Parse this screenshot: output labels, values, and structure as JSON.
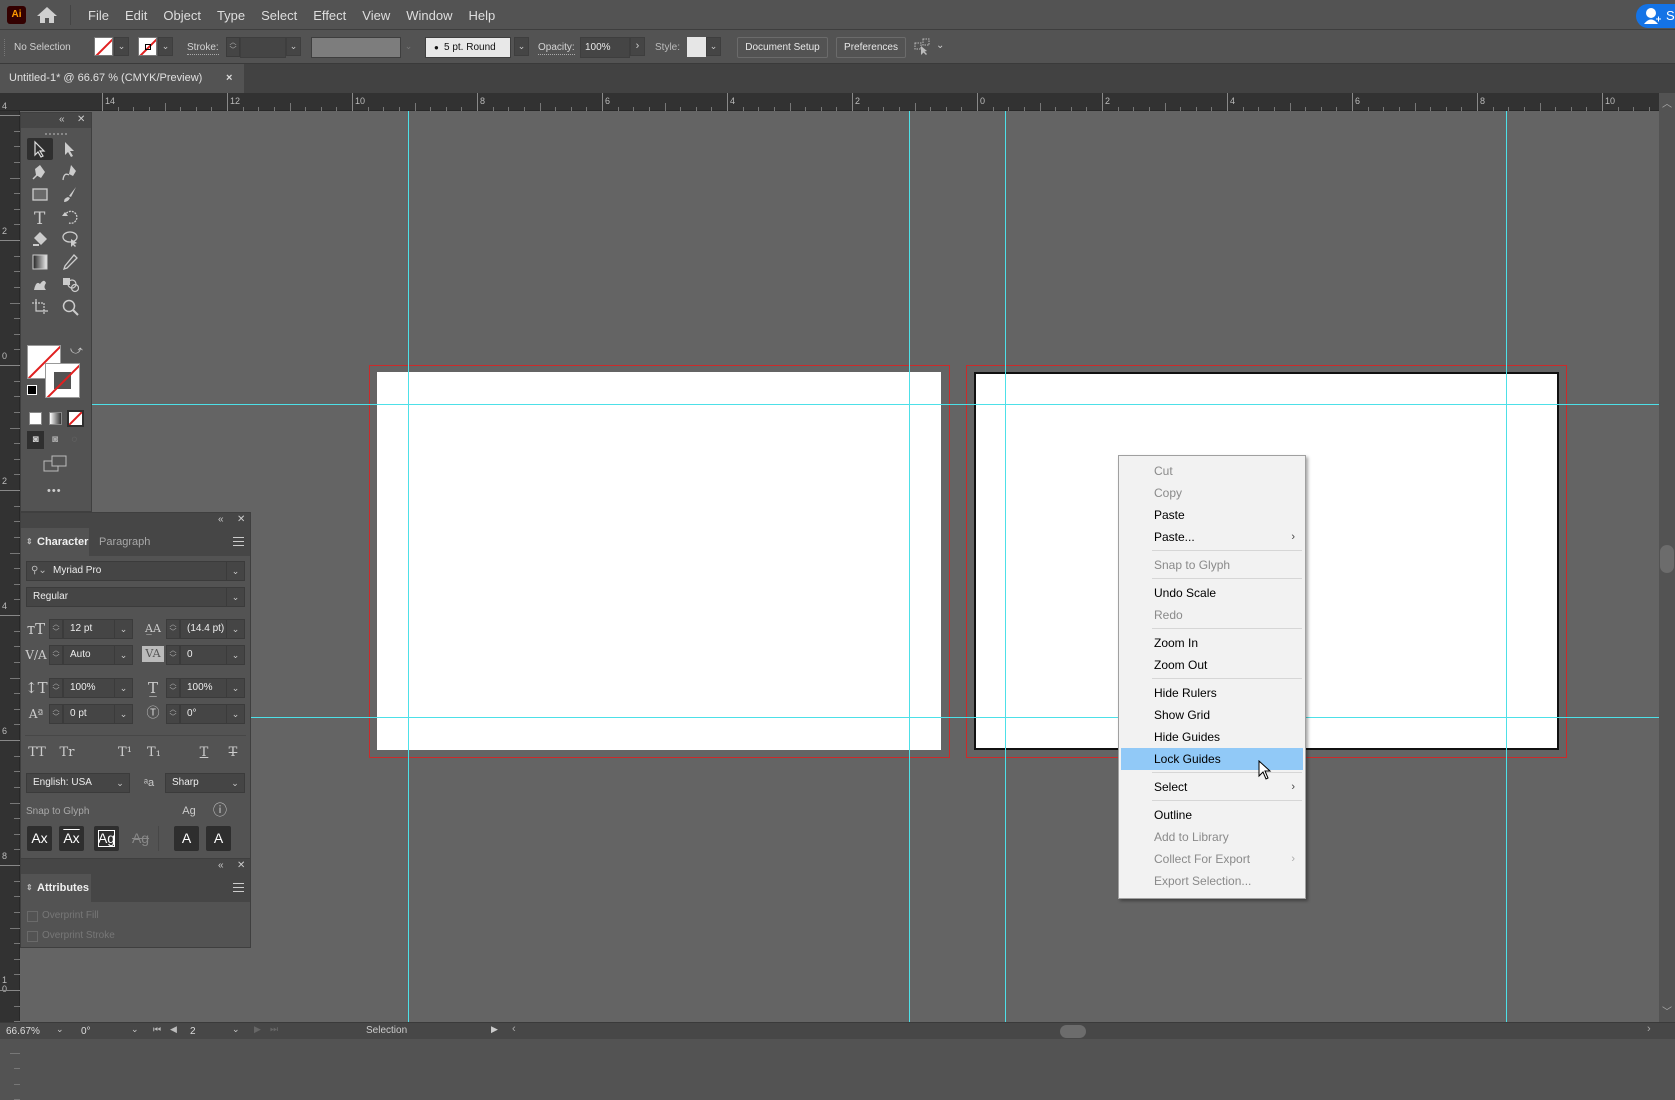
{
  "app": {
    "logo": "Ai",
    "menus": [
      "File",
      "Edit",
      "Object",
      "Type",
      "Select",
      "Effect",
      "View",
      "Window",
      "Help"
    ],
    "share_label": "S"
  },
  "control_bar": {
    "selection_status": "No Selection",
    "stroke_label": "Stroke:",
    "stroke_value": "",
    "brush_label": "5 pt. Round",
    "opacity_label": "Opacity:",
    "opacity_value": "100%",
    "style_label": "Style:",
    "document_setup_label": "Document Setup",
    "preferences_label": "Preferences"
  },
  "document_tab": {
    "title": "Untitled-1* @ 66.67 % (CMYK/Preview)",
    "close_glyph": "×"
  },
  "rulers": {
    "horizontal_labels": [
      "14",
      "12",
      "10",
      "8",
      "6",
      "4",
      "2",
      "0",
      "2",
      "4",
      "6",
      "8",
      "10"
    ],
    "vertical_labels": [
      "4",
      "2",
      "0",
      "2",
      "4",
      "6",
      "8",
      "10"
    ]
  },
  "tools_panel": {
    "tools": [
      {
        "name": "selection-tool",
        "active": true
      },
      {
        "name": "direct-selection-tool",
        "active": false
      },
      {
        "name": "pen-tool",
        "active": false
      },
      {
        "name": "curvature-tool",
        "active": false
      },
      {
        "name": "rectangle-tool",
        "active": false
      },
      {
        "name": "paintbrush-tool",
        "active": false
      },
      {
        "name": "type-tool",
        "active": false
      },
      {
        "name": "rotate-tool",
        "active": false
      },
      {
        "name": "eraser-tool",
        "active": false
      },
      {
        "name": "lasso-tool",
        "active": false
      },
      {
        "name": "gradient-tool",
        "active": false
      },
      {
        "name": "eyedropper-tool",
        "active": false
      },
      {
        "name": "puppet-warp-tool",
        "active": false
      },
      {
        "name": "shape-builder-tool",
        "active": false
      },
      {
        "name": "artboard-tool",
        "active": false
      },
      {
        "name": "zoom-tool",
        "active": false
      }
    ],
    "more_label": "•••"
  },
  "character_panel": {
    "tabs": [
      "Character",
      "Paragraph"
    ],
    "active_tab": "Character",
    "font_family": "Myriad Pro",
    "font_style": "Regular",
    "font_size": "12 pt",
    "leading": "(14.4 pt)",
    "kerning": "Auto",
    "tracking": "0",
    "vertical_scale": "100%",
    "horizontal_scale": "100%",
    "baseline_shift": "0 pt",
    "character_rotation": "0°",
    "case_buttons": [
      "TT",
      "Tr",
      "T¹",
      "T₁",
      "T",
      "T"
    ],
    "language": "English: USA",
    "antialiasing": "Sharp",
    "snap_to_glyph_label": "Snap to Glyph",
    "snap_buttons": [
      "Ax",
      "Ax",
      "Ag",
      "Ag",
      "A",
      "A"
    ]
  },
  "attributes_panel": {
    "title": "Attributes",
    "options": [
      {
        "label": "Overprint Fill",
        "checked": false
      },
      {
        "label": "Overprint Stroke",
        "checked": false
      }
    ]
  },
  "context_menu": {
    "groups": [
      [
        {
          "label": "Cut",
          "enabled": false,
          "submenu": false
        },
        {
          "label": "Copy",
          "enabled": false,
          "submenu": false
        },
        {
          "label": "Paste",
          "enabled": true,
          "submenu": false
        },
        {
          "label": "Paste...",
          "enabled": true,
          "submenu": true
        }
      ],
      [
        {
          "label": "Snap to Glyph",
          "enabled": false,
          "submenu": false
        }
      ],
      [
        {
          "label": "Undo Scale",
          "enabled": true,
          "submenu": false
        },
        {
          "label": "Redo",
          "enabled": false,
          "submenu": false
        }
      ],
      [
        {
          "label": "Zoom In",
          "enabled": true,
          "submenu": false
        },
        {
          "label": "Zoom Out",
          "enabled": true,
          "submenu": false
        }
      ],
      [
        {
          "label": "Hide Rulers",
          "enabled": true,
          "submenu": false
        },
        {
          "label": "Show Grid",
          "enabled": true,
          "submenu": false
        },
        {
          "label": "Hide Guides",
          "enabled": true,
          "submenu": false
        },
        {
          "label": "Lock Guides",
          "enabled": true,
          "submenu": false,
          "highlighted": true
        }
      ],
      [
        {
          "label": "Select",
          "enabled": true,
          "submenu": true
        }
      ],
      [
        {
          "label": "Outline",
          "enabled": true,
          "submenu": false
        },
        {
          "label": "Add to Library",
          "enabled": false,
          "submenu": false
        },
        {
          "label": "Collect For Export",
          "enabled": false,
          "submenu": true
        },
        {
          "label": "Export Selection...",
          "enabled": false,
          "submenu": false
        }
      ]
    ],
    "submenu_glyph": "›"
  },
  "status_bar": {
    "zoom": "66.67%",
    "rotation": "0°",
    "artboard_number": "2",
    "current_tool": "Selection"
  },
  "colors": {
    "guide": "#4de0e8",
    "bleed": "#cc2a2a",
    "menu_highlight": "#91c9f7",
    "share_button": "#1473e6"
  }
}
